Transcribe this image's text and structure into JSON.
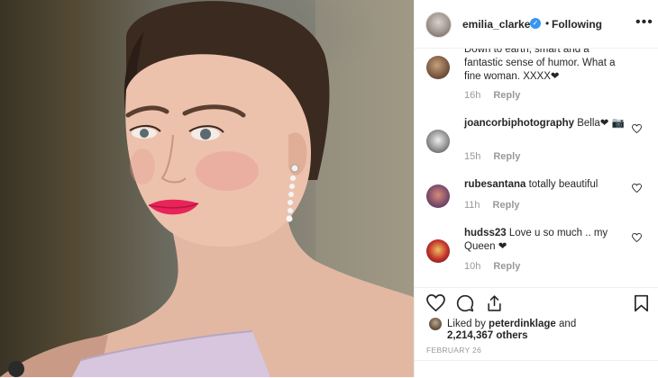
{
  "post": {
    "username": "emilia_clarke",
    "follow_status": "Following",
    "separator": "•"
  },
  "comments": [
    {
      "text": "Down to earth, smart and a fantastic sense of humor. What a fine woman. XXXX❤",
      "time": "16h",
      "reply": "Reply"
    },
    {
      "user": "joancorbiphotography",
      "text": "Bella❤ 📷",
      "time": "15h",
      "reply": "Reply"
    },
    {
      "user": "rubesantana",
      "text": "totally beautiful",
      "time": "11h",
      "reply": "Reply"
    },
    {
      "user": "hudss23",
      "text": "Love u so much .. my Queen ❤",
      "time": "10h",
      "reply": "Reply"
    }
  ],
  "likes": {
    "liked_by_prefix": "Liked by",
    "liker": "peterdinklage",
    "conjunction": "and",
    "count": "2,214,367 others"
  },
  "date": "FEBRUARY 26",
  "icons": [
    "verified-icon",
    "more-options-icon",
    "heart-icon",
    "comment-icon",
    "share-icon",
    "bookmark-icon"
  ],
  "colors": {
    "accent": "#3897f0",
    "lipstick": "#e8245a",
    "meta": "#999999"
  }
}
